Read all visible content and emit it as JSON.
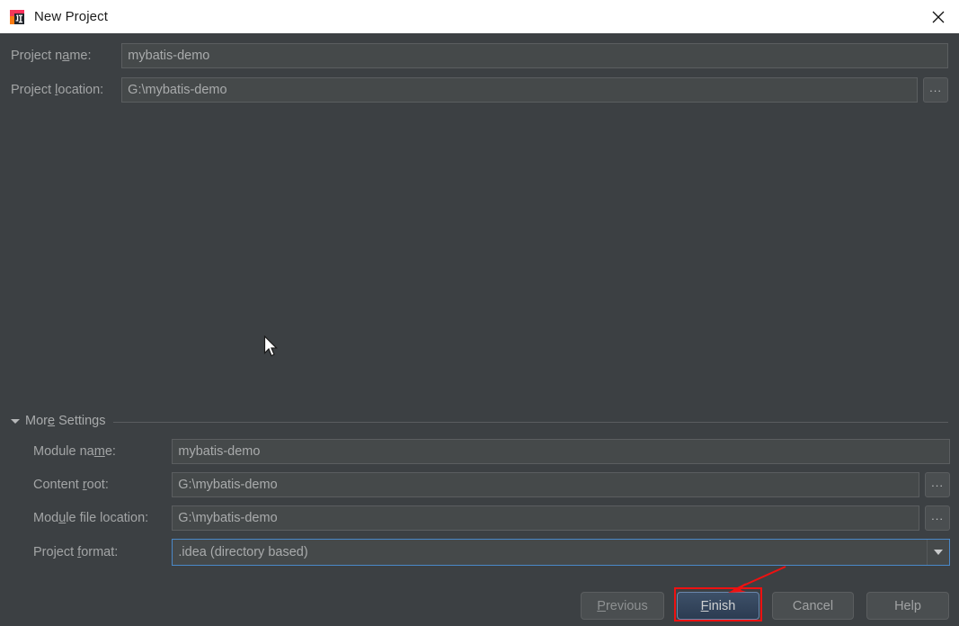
{
  "window": {
    "title": "New Project",
    "icon": "intellij-idea-icon",
    "close_label": "close-icon",
    "titlebar_bg": "#ffffff",
    "body_bg": "#3c4043"
  },
  "top_form": {
    "project_name": {
      "label_before": "Project n",
      "label_mnemonic": "a",
      "label_after": "me:",
      "value": "mybatis-demo",
      "placeholder": ""
    },
    "project_location": {
      "label_before": "Project ",
      "label_mnemonic": "l",
      "label_after": "ocation:",
      "value": "G:\\mybatis-demo",
      "placeholder": "",
      "browse_label": "..."
    }
  },
  "more_settings": {
    "label_before": "Mor",
    "label_mnemonic": "e",
    "label_after": " Settings",
    "expanded": true,
    "toggle_icon": "triangle-down-icon"
  },
  "settings_form": {
    "module_name": {
      "label_before": "Module na",
      "label_mnemonic": "m",
      "label_after": "e:",
      "value": "mybatis-demo"
    },
    "content_root": {
      "label_before": "Content ",
      "label_mnemonic": "r",
      "label_after": "oot:",
      "value": "G:\\mybatis-demo",
      "browse_label": "..."
    },
    "module_file_location": {
      "label_before": "Mod",
      "label_mnemonic": "u",
      "label_after": "le file location:",
      "value": "G:\\mybatis-demo",
      "browse_label": "..."
    },
    "project_format": {
      "label_before": "Project ",
      "label_mnemonic": "f",
      "label_after": "ormat:",
      "value": ".idea (directory based)",
      "focused": true,
      "arrow_icon": "chevron-down-icon"
    }
  },
  "buttons": {
    "previous": {
      "before": "",
      "mnemonic": "P",
      "after": "revious",
      "enabled": false
    },
    "finish": {
      "before": "",
      "mnemonic": "F",
      "after": "inish",
      "is_default": true
    },
    "cancel": {
      "before": "Cancel",
      "mnemonic": "",
      "after": ""
    },
    "help": {
      "before": "Help",
      "mnemonic": "",
      "after": ""
    }
  },
  "annotations": {
    "highlight_color": "#ee1111",
    "highlight_target": "finish-button",
    "arrow": "red-arrow-pointing-to-finish"
  },
  "colors": {
    "accent_focus": "#4a88c7",
    "field_bg": "#45494a",
    "field_border": "#5b5e60",
    "text": "#a3a5a6",
    "annotation_red": "#ee1111"
  }
}
